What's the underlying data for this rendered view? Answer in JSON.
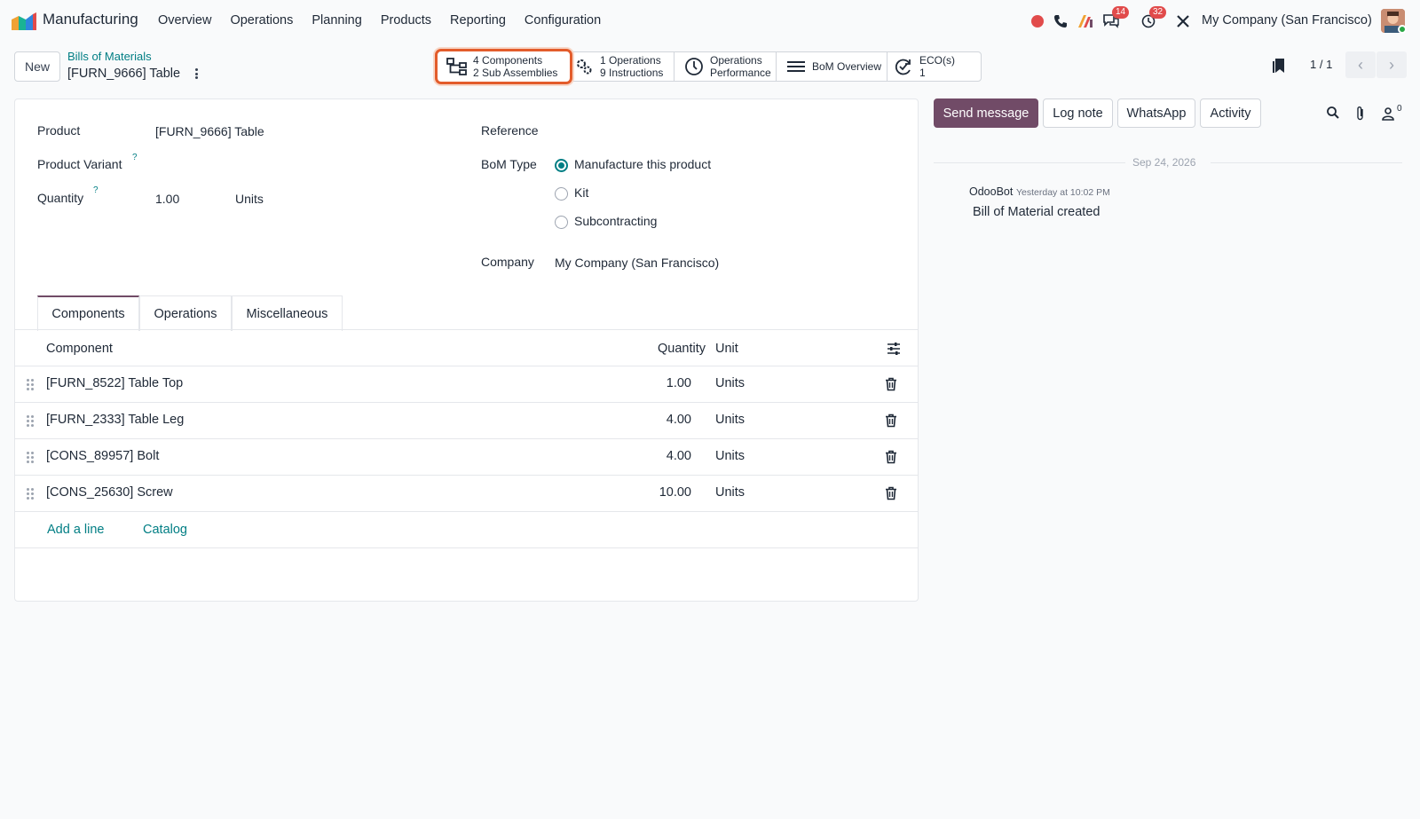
{
  "navbar": {
    "app_name": "Manufacturing",
    "menu": [
      "Overview",
      "Operations",
      "Planning",
      "Products",
      "Reporting",
      "Configuration"
    ],
    "messages_badge": "14",
    "activities_badge": "32",
    "company": "My Company (San Francisco)"
  },
  "control_panel": {
    "new_label": "New",
    "breadcrumb_parent": "Bills of Materials",
    "breadcrumb_current": "[FURN_9666] Table",
    "smart_buttons": {
      "components_count": "4",
      "components_label": "Components",
      "subassemblies_count": "2",
      "subassemblies_label": "Sub Assemblies",
      "operations_count": "1",
      "operations_label": "Operations",
      "instructions_count": "9",
      "instructions_label": "Instructions",
      "perf_line1": "Operations",
      "perf_line2": "Performance",
      "bom_overview": "BoM Overview",
      "eco_label": "ECO(s)",
      "eco_count": "1"
    },
    "pager": "1 / 1"
  },
  "form": {
    "product_label": "Product",
    "product_value": "[FURN_9666] Table",
    "variant_label": "Product Variant",
    "quantity_label": "Quantity",
    "quantity_value": "1.00",
    "quantity_unit": "Units",
    "help_mark": "?",
    "reference_label": "Reference",
    "bom_type_label": "BoM Type",
    "bom_types": [
      "Manufacture this product",
      "Kit",
      "Subcontracting"
    ],
    "bom_type_selected": "Manufacture this product",
    "company_label": "Company",
    "company_value": "My Company (San Francisco)"
  },
  "tabs": [
    "Components",
    "Operations",
    "Miscellaneous"
  ],
  "components_table": {
    "columns": [
      "Component",
      "Quantity",
      "Unit"
    ],
    "rows": [
      {
        "component": "[FURN_8522] Table Top",
        "quantity": "1.00",
        "unit": "Units"
      },
      {
        "component": "[FURN_2333] Table Leg",
        "quantity": "4.00",
        "unit": "Units"
      },
      {
        "component": "[CONS_89957] Bolt",
        "quantity": "4.00",
        "unit": "Units"
      },
      {
        "component": "[CONS_25630] Screw",
        "quantity": "10.00",
        "unit": "Units"
      }
    ],
    "add_line": "Add a line",
    "catalog": "Catalog"
  },
  "chatter": {
    "send_message": "Send message",
    "log_note": "Log note",
    "whatsapp": "WhatsApp",
    "activity": "Activity",
    "followers_count": "0",
    "date": "Sep 24, 2026",
    "author": "OdooBot",
    "time": "Yesterday at 10:02 PM",
    "body": "Bill of Material created"
  },
  "colors": {
    "brand": "#714b67",
    "link": "#017e84",
    "highlight": "#e35c2b"
  }
}
